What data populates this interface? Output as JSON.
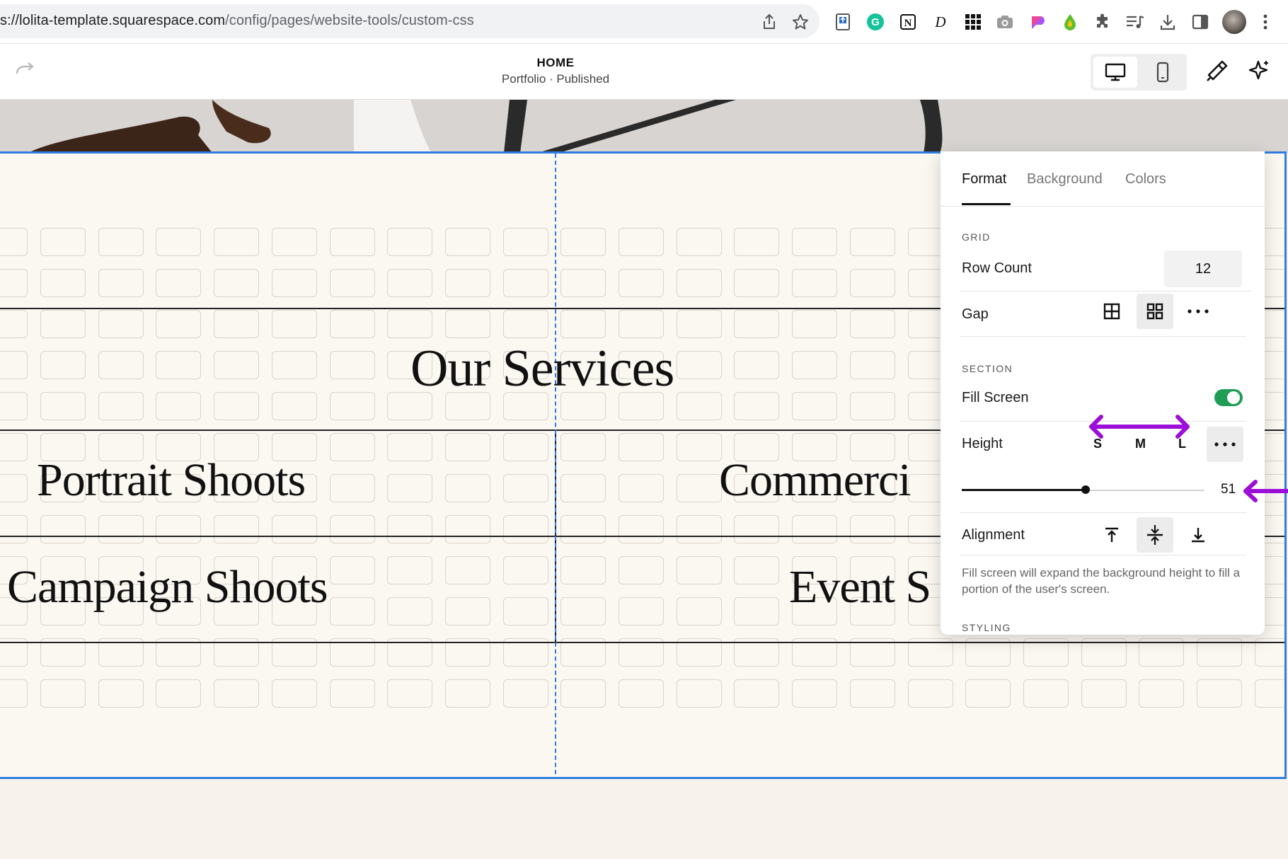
{
  "browser": {
    "url_host": "s://lolita-template.squarespace.com",
    "url_path": "/config/pages/website-tools/custom-css",
    "toolbar_icons": [
      "share-icon",
      "star-icon",
      "extension-pdf-icon",
      "grammarly-icon",
      "notion-icon",
      "dash-d-icon",
      "grid-apps-icon",
      "camera-icon",
      "gradient-extension-icon",
      "drop-extension-icon",
      "puzzle-icon",
      "playlist-icon",
      "download-icon",
      "sidepanel-icon",
      "profile-avatar",
      "kebab-menu-icon"
    ]
  },
  "editor": {
    "page_title": "HOME",
    "page_subtitle": "Portfolio · Published",
    "icons": [
      "redo-icon",
      "desktop-icon",
      "mobile-icon",
      "paintbrush-icon",
      "sparkle-icon"
    ]
  },
  "canvas": {
    "heading": "Our Services",
    "items": [
      "Portrait Shoots",
      "Commerci",
      "Campaign Shoots",
      "Event S"
    ]
  },
  "panel": {
    "tabs": [
      "Format",
      "Background",
      "Colors"
    ],
    "active_tab": "Format",
    "grid_header": "GRID",
    "row_count_label": "Row Count",
    "row_count_value": "12",
    "gap_label": "Gap",
    "section_header": "SECTION",
    "fill_screen_label": "Fill Screen",
    "fill_screen_on": true,
    "height_label": "Height",
    "height_sizes": [
      "S",
      "M",
      "L"
    ],
    "height_value": "51",
    "height_value_fraction": 0.51,
    "alignment_label": "Alignment",
    "help_text": "Fill screen will expand the background height to fill a portion of the user's screen.",
    "styling_header": "STYLING"
  },
  "annotations": {
    "arrow_color": "#9b0fd8"
  },
  "colors": {
    "selection_blue": "#2f7de1",
    "toggle_green": "#1f9d55",
    "canvas_bg": "#fbf8f2"
  }
}
